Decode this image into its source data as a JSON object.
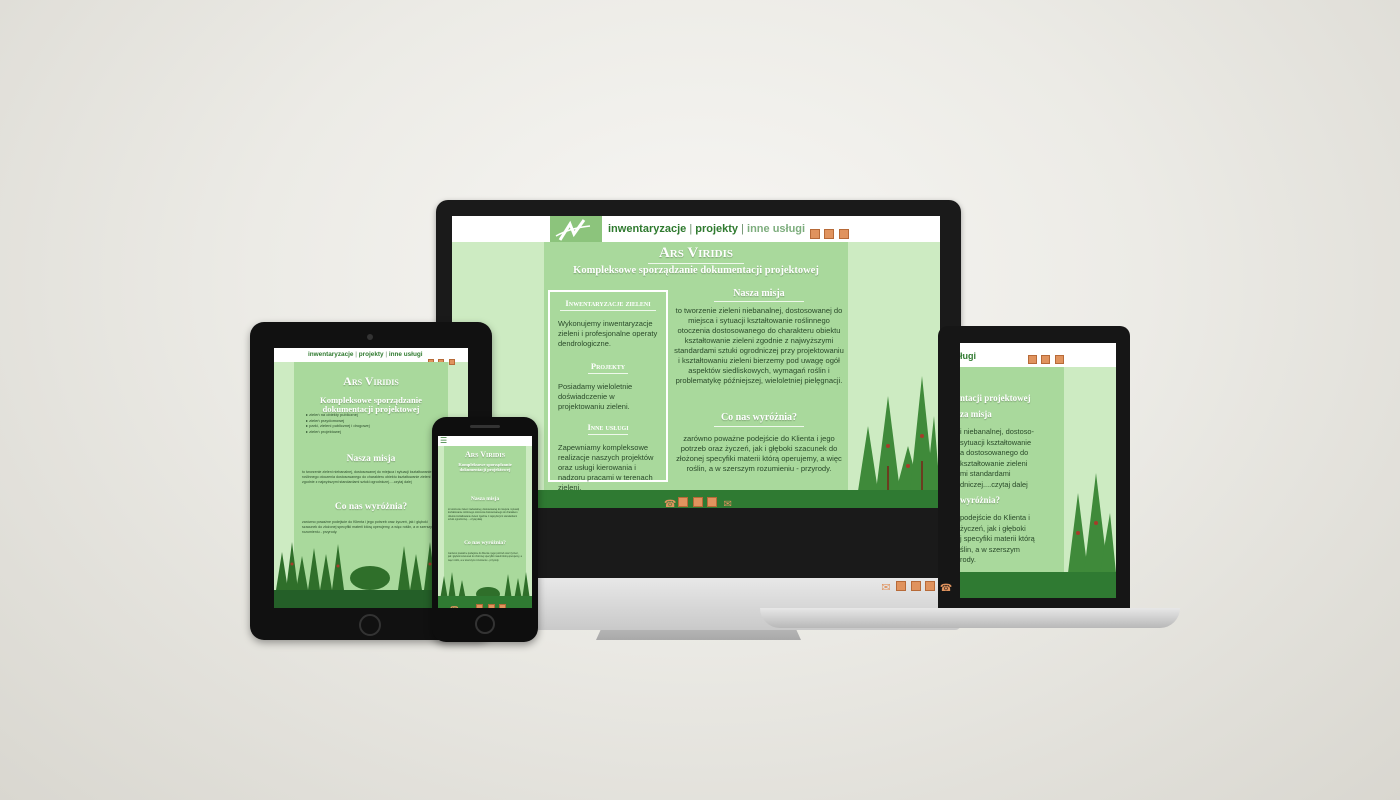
{
  "site": {
    "nav": {
      "item1": "inwentaryzacje",
      "sep1": "|",
      "item2": "projekty",
      "sep2": "|",
      "item3": "inne usługi"
    },
    "title": "Ars Viridis",
    "subtitle": "Kompleksowe sporządzanie dokumentacji projektowej",
    "sections": {
      "inwentaryzacje_title": "Inwentaryzacje zieleni",
      "inwentaryzacje_text": "Wykonujemy inwentaryzacje zieleni i profesjonalne operaty dendrologiczne.",
      "projekty_title": "Projekty",
      "projekty_text": "Posiadamy wieloletnie doświadczenie w projektowaniu zieleni.",
      "inne_title": "Inne usługi",
      "inne_text": "Zapewniamy kompleksowe realizacje naszych projektów oraz usługi kierowania i nadzoru pracami w terenach zieleni."
    },
    "mission_title": "Nasza misja",
    "mission_text": "to tworzenie zieleni niebanalnej, dostosowanej do miejsca i sytuacji kształtowanie roślinnego otoczenia dostosowanego do charakteru obiektu kształtowanie zieleni zgodnie z najwyższymi standardami sztuki ogrodniczej przy projektowaniu i kształtowaniu zieleni bierzemy pod uwagę ogół aspektów siedliskowych, wymagań roślin i problematykę późniejszej, wieloletniej pielęgnacji.",
    "distinct_title": "Co nas wyróżnia?",
    "distinct_text": "zarówno poważne podejście do Klienta i jego potrzeb oraz życzeń, jak i głęboki szacunek do złożonej specyfiki materii którą operujemy, a więc roślin, a w szerszym rozumieniu - przyrody."
  },
  "laptop": {
    "nav_tail": "ługi",
    "subtitle_tail": "ntacji projektowej",
    "mission_tail": "za misja",
    "text_lines": [
      "i niebanalnej, dostoso-",
      "sytuacji kształtowanie",
      "a dostosowanego do",
      "kształtowanie zieleni",
      "mi standardami",
      "dniczej....czytaj dalej"
    ],
    "distinct_tail": "wyróżnia?",
    "distinct_lines": [
      "podejście do Klienta i",
      "życzeń, jak i głęboki",
      "j specyfiki materii którą",
      "ślin, a w szerszym",
      "rody."
    ]
  },
  "tablet": {
    "list": [
      "zieleń na obiekty publicznej",
      "zieleń przydomowej",
      "parki, zieleni publicznej i drogowej",
      "zieleń projektowej"
    ],
    "mission_text": "to tworzenie zieleni niebanalnej, dostosowanej do miejsca i sytuacji kształtowanie roślinnego otoczenia dostosowanego do charakteru obiektu kształtowanie zieleni zgodnie z najwyższymi standardami sztuki ogrodniczej.....czytaj dalej",
    "distinct_text": "zarówno poważne podejście do Klienta i jego potrzeb oraz życzeń, jak i głęboki szacunek do złożonej specyfiki materii którą operujemy, a więc roślin, a w szerszym rozumieniu - przyrody."
  },
  "colors": {
    "accent": "#2f7a2f",
    "bg": "#cdebc2",
    "column": "#a9d99c",
    "footer": "#2f7a32",
    "icon": "#e0935e"
  }
}
